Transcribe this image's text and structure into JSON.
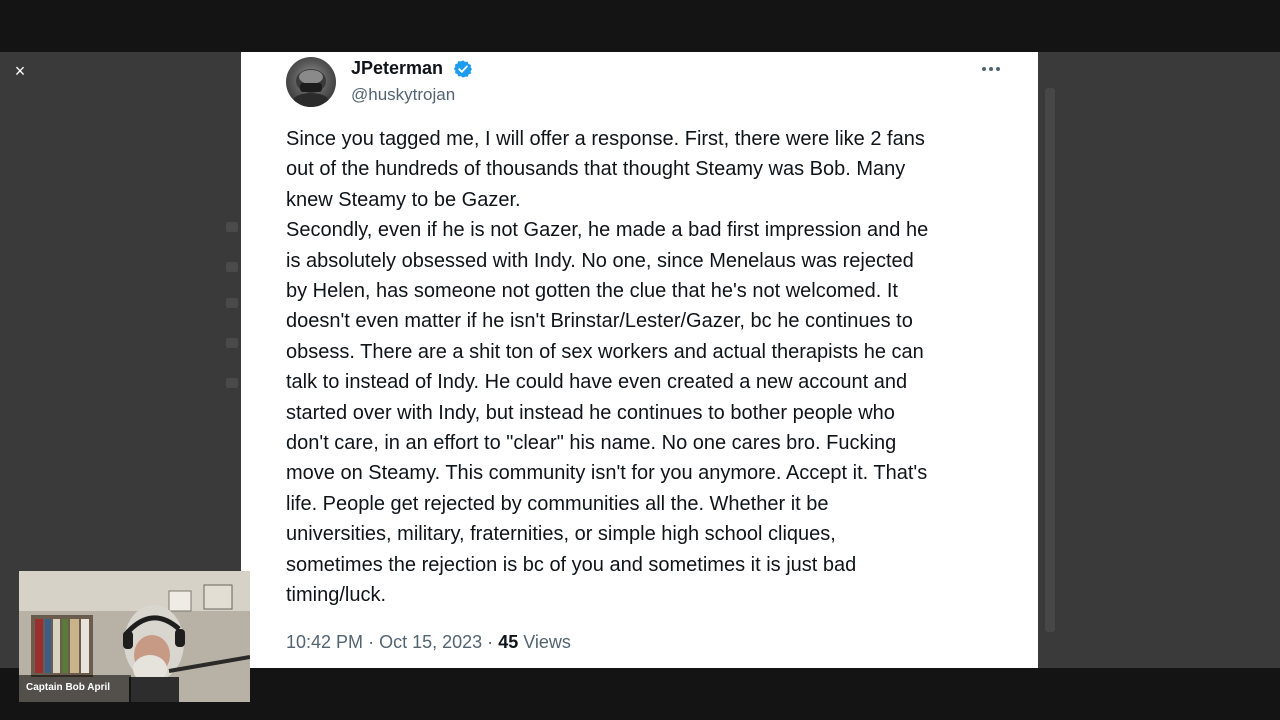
{
  "viewer": {
    "close_icon": "close-icon",
    "close_glyph": "×"
  },
  "tweet": {
    "author": {
      "display_name": "JPeterman",
      "handle": "@huskytrojan",
      "verified": true,
      "verified_color": "#1d9bf0"
    },
    "more_icon": "more-horizontal-icon",
    "lines": [
      "Since you tagged me, I will offer a response. First, there were like 2 fans",
      "out of the hundreds of thousands that thought Steamy was Bob. Many",
      "knew Steamy to be Gazer.",
      "Secondly, even if he is not Gazer, he made a bad first impression and he",
      "is absolutely obsessed with Indy. No one, since Menelaus was rejected",
      "by Helen, has someone not gotten the clue that he's not welcomed. It",
      "doesn't even matter if he isn't Brinstar/Lester/Gazer, bc he continues to",
      "obsess. There are a shit ton of sex workers and actual therapists he can",
      "talk to instead of Indy. He could have even created a new account and",
      "started over with Indy, but instead he continues to bother people who",
      "don't care, in an effort to \"clear\" his name. No one cares bro. Fucking",
      "move on Steamy. This community isn't for you anymore. Accept it. That's",
      "life. People get rejected by communities all the. Whether it be",
      "universities, military, fraternities, or simple high school cliques,",
      "sometimes the rejection is bc of you and sometimes it is just bad",
      "timing/luck."
    ],
    "time": "10:42 PM",
    "separator": "·",
    "date": "Oct 15, 2023",
    "views_count": "45",
    "views_label": "Views"
  },
  "webcam": {
    "name": "Captain Bob April"
  },
  "colors": {
    "text_primary": "#0f1419",
    "text_secondary": "#536471",
    "backdrop": "#3a3a3a",
    "bars": "#141414"
  }
}
